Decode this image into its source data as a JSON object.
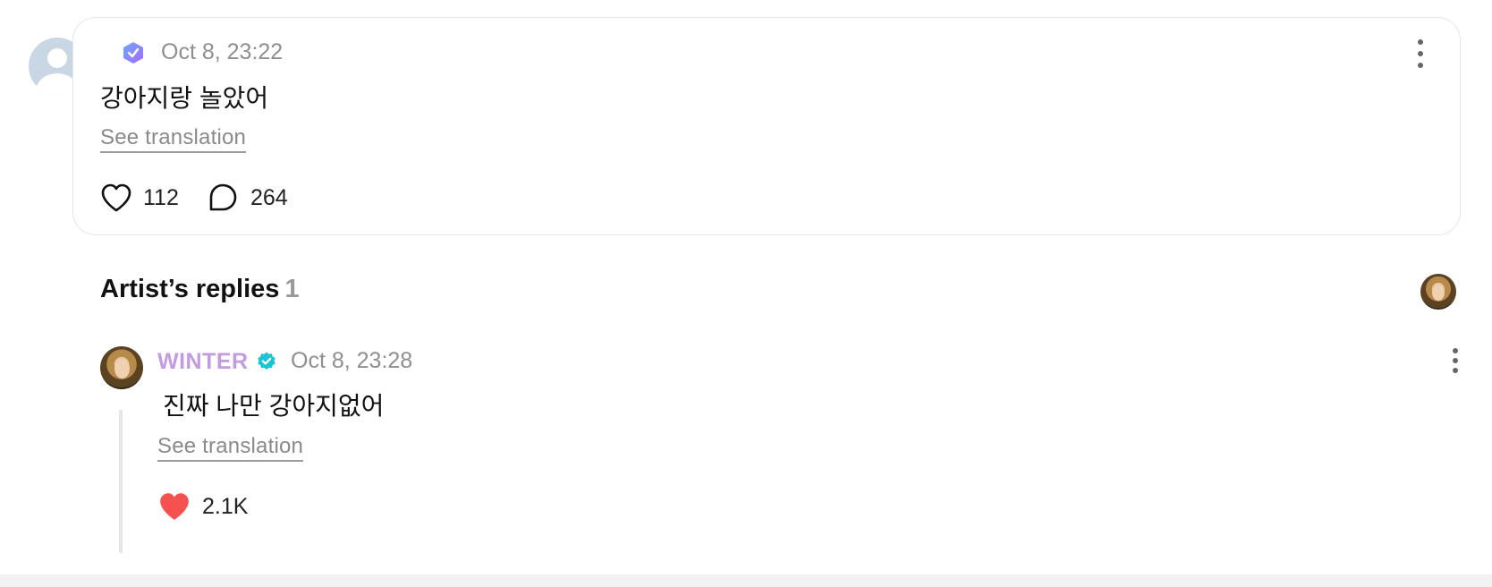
{
  "comment": {
    "timestamp": "Oct 8, 23:22",
    "text": "강아지랑 놀았어",
    "see_translation": "See translation",
    "likes": "112",
    "replies": "264"
  },
  "artist_replies": {
    "title": "Artist’s replies",
    "count": "1",
    "reply": {
      "username": "WINTER",
      "timestamp": "Oct 8, 23:28",
      "text": "진짜 나만 강아지없어",
      "see_translation": "See translation",
      "likes": "2.1K"
    }
  },
  "colors": {
    "username": "#c39be0",
    "verified": "#1fc3d6",
    "liked_heart": "#f5514f",
    "muted_text": "#8e8e93"
  },
  "icons": [
    "user-avatar-icon",
    "membership-badge-icon",
    "more-options-icon",
    "heart-outline-icon",
    "comment-bubble-icon",
    "verified-icon",
    "heart-filled-icon"
  ]
}
